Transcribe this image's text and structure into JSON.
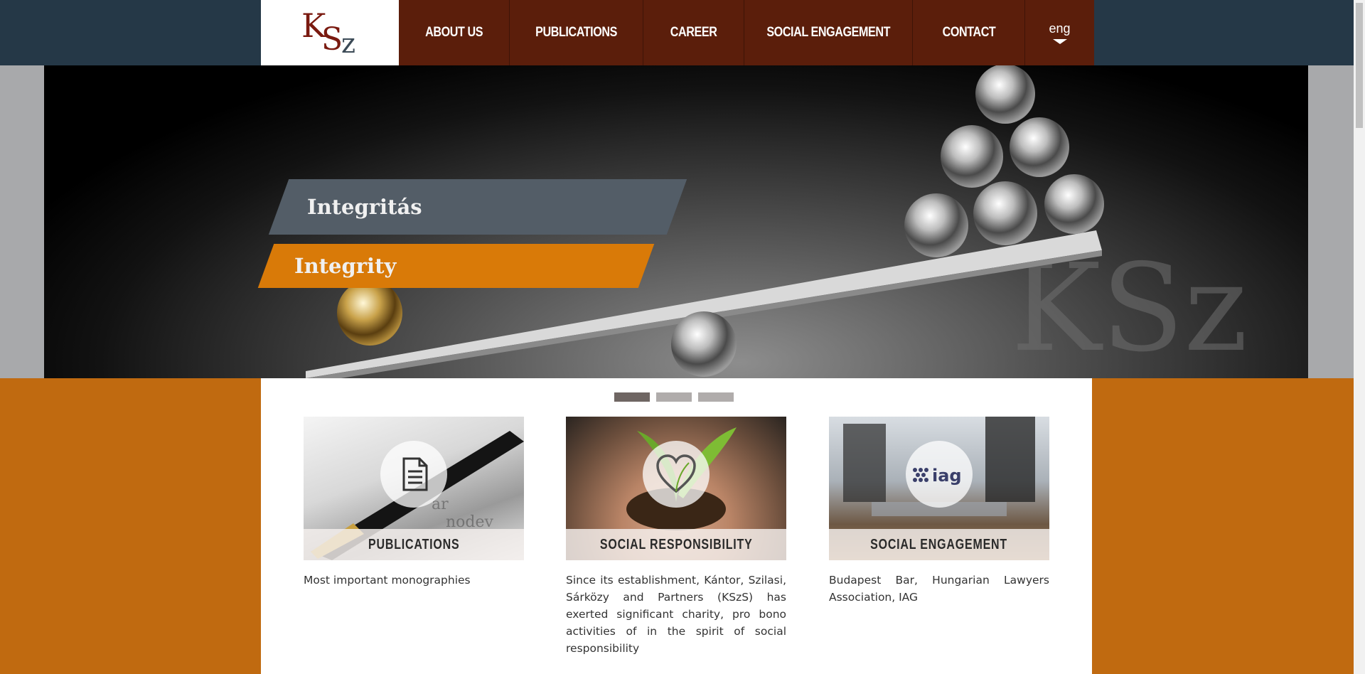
{
  "brand": {
    "logo_text": "KSzS"
  },
  "nav": {
    "items": [
      {
        "label": "ABOUT US"
      },
      {
        "label": "PUBLICATIONS"
      },
      {
        "label": "CAREER"
      },
      {
        "label": "SOCIAL ENGAGEMENT"
      },
      {
        "label": "CONTACT"
      }
    ],
    "lang": "eng"
  },
  "hero": {
    "slide_title_hu": "Integritás",
    "slide_title_en": "Integrity",
    "watermark": "KSz",
    "slides_count": 3,
    "active_slide": 1
  },
  "cards": [
    {
      "title": "PUBLICATIONS",
      "icon": "document-icon",
      "text": "Most important monographies"
    },
    {
      "title": "SOCIAL RESPONSIBILITY",
      "icon": "heart-icon",
      "text": "Since its establishment, Kántor, Szilasi, Sárközy and Partners (KSzS) has exerted significant charity, pro bono activities  of in the spirit of social responsibility"
    },
    {
      "title": "SOCIAL ENGAGEMENT",
      "icon": "iag-logo-icon",
      "icon_text": "iag",
      "text": "Budapest Bar, Hungarian Lawyers Association, IAG"
    }
  ],
  "colors": {
    "topbar": "#253847",
    "nav": "#5b1e0b",
    "accent_orange": "#d97a08",
    "banner_gray": "#535d67",
    "page_orange": "#c06a10"
  }
}
